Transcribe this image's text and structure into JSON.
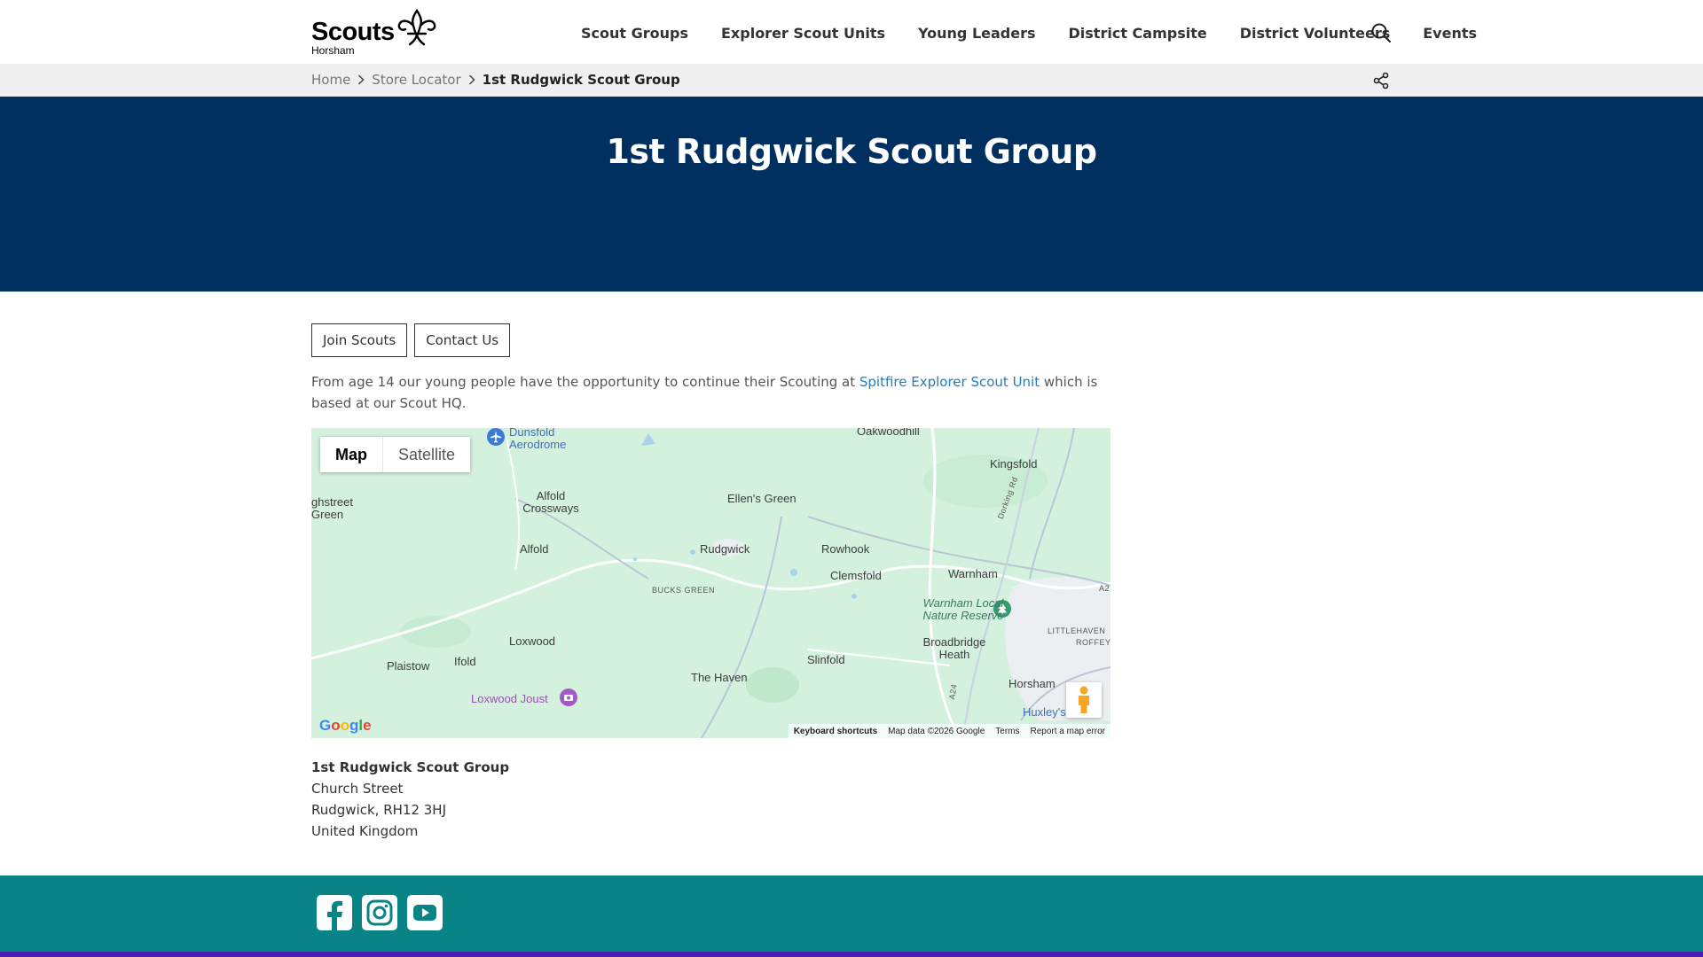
{
  "brand": {
    "name": "Scouts",
    "district": "Horsham"
  },
  "nav": {
    "items": [
      "Scout Groups",
      "Explorer Scout Units",
      "Young Leaders",
      "District Campsite",
      "District Volunteers",
      "Events"
    ]
  },
  "breadcrumb": {
    "items": [
      "Home",
      "Store Locator"
    ],
    "current": "1st Rudgwick Scout Group"
  },
  "hero": {
    "title": "1st Rudgwick Scout Group"
  },
  "actions": {
    "join_label": "Join Scouts",
    "contact_label": "Contact Us"
  },
  "intro": {
    "before": "From age 14 our young people have the opportunity to continue their Scouting at ",
    "link": "Spitfire Explorer Scout Unit",
    "after": " which is based at our Scout HQ."
  },
  "map": {
    "map_label": "Map",
    "satellite_label": "Satellite",
    "places": {
      "dunsfold": "Dunsfold Aerodrome",
      "oakwoodhill": "Oakwoodhill",
      "kingsfold": "Kingsfold",
      "highstreet": "ghstreet Green",
      "alfold_crossways": "Alfold Crossways",
      "ellens_green": "Ellen's Green",
      "alfold": "Alfold",
      "rudgwick": "Rudgwick",
      "rowhook": "Rowhook",
      "clemsfold": "Clemsfold",
      "warnham": "Warnham",
      "bucks_green": "BUCKS GREEN",
      "warnham_nr": "Warnham Local Nature Reserve",
      "littlehaven": "LITTLEHAVEN",
      "roffey": "ROFFEY",
      "loxwood": "Loxwood",
      "broadbridge": "Broadbridge Heath",
      "plaistow": "Plaistow",
      "ifold": "Ifold",
      "slinfold": "Slinfold",
      "the_haven": "The Haven",
      "horsham": "Horsham",
      "loxwood_joust": "Loxwood Joust",
      "huxleys": "Huxley's",
      "dorking_rd": "Dorking Rd",
      "a24": "A24",
      "a2": "A2"
    },
    "google": "Google",
    "attribution": {
      "keyboard": "Keyboard shortcuts",
      "data": "Map data ©2026 Google",
      "terms": "Terms",
      "report": "Report a map error"
    }
  },
  "address": {
    "name": "1st Rudgwick Scout Group",
    "street": "Church Street",
    "town": "Rudgwick, RH12 3HJ",
    "country": "United Kingdom"
  },
  "colors": {
    "hero": "#003060",
    "footer": "#088486",
    "footer_bottom": "#4a1fb0",
    "link": "#2a7ab8"
  },
  "footer": {
    "icons": [
      "facebook-icon",
      "instagram-icon",
      "youtube-icon"
    ]
  }
}
